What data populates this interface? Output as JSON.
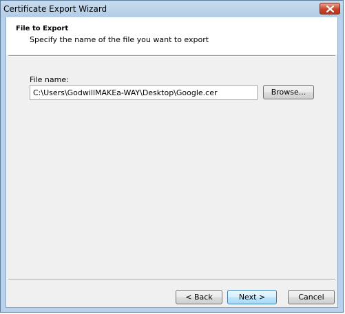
{
  "window": {
    "title": "Certificate Export Wizard"
  },
  "header": {
    "title": "File to Export",
    "subtitle": "Specify the name of the file you want to export"
  },
  "form": {
    "file_name_label": "File name:",
    "file_name_value": "C:\\Users\\GodwillMAKEa-WAY\\Desktop\\Google.cer",
    "browse_label": "Browse..."
  },
  "footer": {
    "back_label": "< Back",
    "next_label": "Next >",
    "cancel_label": "Cancel"
  },
  "icons": {
    "close": "close-icon"
  },
  "colors": {
    "titlebar": "#b9d1ea",
    "close_button": "#c9452a",
    "client_background": "#f0f0f0",
    "header_background": "#ffffff"
  }
}
